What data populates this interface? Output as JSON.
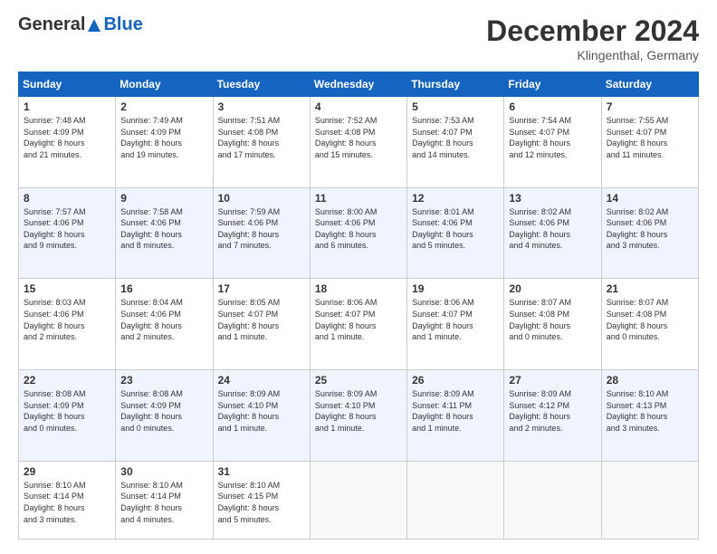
{
  "header": {
    "logo_general": "General",
    "logo_blue": "Blue",
    "month_title": "December 2024",
    "location": "Klingenthal, Germany"
  },
  "weekdays": [
    "Sunday",
    "Monday",
    "Tuesday",
    "Wednesday",
    "Thursday",
    "Friday",
    "Saturday"
  ],
  "rows": [
    [
      {
        "day": "1",
        "lines": [
          "Sunrise: 7:48 AM",
          "Sunset: 4:09 PM",
          "Daylight: 8 hours",
          "and 21 minutes."
        ]
      },
      {
        "day": "2",
        "lines": [
          "Sunrise: 7:49 AM",
          "Sunset: 4:09 PM",
          "Daylight: 8 hours",
          "and 19 minutes."
        ]
      },
      {
        "day": "3",
        "lines": [
          "Sunrise: 7:51 AM",
          "Sunset: 4:08 PM",
          "Daylight: 8 hours",
          "and 17 minutes."
        ]
      },
      {
        "day": "4",
        "lines": [
          "Sunrise: 7:52 AM",
          "Sunset: 4:08 PM",
          "Daylight: 8 hours",
          "and 15 minutes."
        ]
      },
      {
        "day": "5",
        "lines": [
          "Sunrise: 7:53 AM",
          "Sunset: 4:07 PM",
          "Daylight: 8 hours",
          "and 14 minutes."
        ]
      },
      {
        "day": "6",
        "lines": [
          "Sunrise: 7:54 AM",
          "Sunset: 4:07 PM",
          "Daylight: 8 hours",
          "and 12 minutes."
        ]
      },
      {
        "day": "7",
        "lines": [
          "Sunrise: 7:55 AM",
          "Sunset: 4:07 PM",
          "Daylight: 8 hours",
          "and 11 minutes."
        ]
      }
    ],
    [
      {
        "day": "8",
        "lines": [
          "Sunrise: 7:57 AM",
          "Sunset: 4:06 PM",
          "Daylight: 8 hours",
          "and 9 minutes."
        ]
      },
      {
        "day": "9",
        "lines": [
          "Sunrise: 7:58 AM",
          "Sunset: 4:06 PM",
          "Daylight: 8 hours",
          "and 8 minutes."
        ]
      },
      {
        "day": "10",
        "lines": [
          "Sunrise: 7:59 AM",
          "Sunset: 4:06 PM",
          "Daylight: 8 hours",
          "and 7 minutes."
        ]
      },
      {
        "day": "11",
        "lines": [
          "Sunrise: 8:00 AM",
          "Sunset: 4:06 PM",
          "Daylight: 8 hours",
          "and 6 minutes."
        ]
      },
      {
        "day": "12",
        "lines": [
          "Sunrise: 8:01 AM",
          "Sunset: 4:06 PM",
          "Daylight: 8 hours",
          "and 5 minutes."
        ]
      },
      {
        "day": "13",
        "lines": [
          "Sunrise: 8:02 AM",
          "Sunset: 4:06 PM",
          "Daylight: 8 hours",
          "and 4 minutes."
        ]
      },
      {
        "day": "14",
        "lines": [
          "Sunrise: 8:02 AM",
          "Sunset: 4:06 PM",
          "Daylight: 8 hours",
          "and 3 minutes."
        ]
      }
    ],
    [
      {
        "day": "15",
        "lines": [
          "Sunrise: 8:03 AM",
          "Sunset: 4:06 PM",
          "Daylight: 8 hours",
          "and 2 minutes."
        ]
      },
      {
        "day": "16",
        "lines": [
          "Sunrise: 8:04 AM",
          "Sunset: 4:06 PM",
          "Daylight: 8 hours",
          "and 2 minutes."
        ]
      },
      {
        "day": "17",
        "lines": [
          "Sunrise: 8:05 AM",
          "Sunset: 4:07 PM",
          "Daylight: 8 hours",
          "and 1 minute."
        ]
      },
      {
        "day": "18",
        "lines": [
          "Sunrise: 8:06 AM",
          "Sunset: 4:07 PM",
          "Daylight: 8 hours",
          "and 1 minute."
        ]
      },
      {
        "day": "19",
        "lines": [
          "Sunrise: 8:06 AM",
          "Sunset: 4:07 PM",
          "Daylight: 8 hours",
          "and 1 minute."
        ]
      },
      {
        "day": "20",
        "lines": [
          "Sunrise: 8:07 AM",
          "Sunset: 4:08 PM",
          "Daylight: 8 hours",
          "and 0 minutes."
        ]
      },
      {
        "day": "21",
        "lines": [
          "Sunrise: 8:07 AM",
          "Sunset: 4:08 PM",
          "Daylight: 8 hours",
          "and 0 minutes."
        ]
      }
    ],
    [
      {
        "day": "22",
        "lines": [
          "Sunrise: 8:08 AM",
          "Sunset: 4:09 PM",
          "Daylight: 8 hours",
          "and 0 minutes."
        ]
      },
      {
        "day": "23",
        "lines": [
          "Sunrise: 8:08 AM",
          "Sunset: 4:09 PM",
          "Daylight: 8 hours",
          "and 0 minutes."
        ]
      },
      {
        "day": "24",
        "lines": [
          "Sunrise: 8:09 AM",
          "Sunset: 4:10 PM",
          "Daylight: 8 hours",
          "and 1 minute."
        ]
      },
      {
        "day": "25",
        "lines": [
          "Sunrise: 8:09 AM",
          "Sunset: 4:10 PM",
          "Daylight: 8 hours",
          "and 1 minute."
        ]
      },
      {
        "day": "26",
        "lines": [
          "Sunrise: 8:09 AM",
          "Sunset: 4:11 PM",
          "Daylight: 8 hours",
          "and 1 minute."
        ]
      },
      {
        "day": "27",
        "lines": [
          "Sunrise: 8:09 AM",
          "Sunset: 4:12 PM",
          "Daylight: 8 hours",
          "and 2 minutes."
        ]
      },
      {
        "day": "28",
        "lines": [
          "Sunrise: 8:10 AM",
          "Sunset: 4:13 PM",
          "Daylight: 8 hours",
          "and 3 minutes."
        ]
      }
    ],
    [
      {
        "day": "29",
        "lines": [
          "Sunrise: 8:10 AM",
          "Sunset: 4:14 PM",
          "Daylight: 8 hours",
          "and 3 minutes."
        ]
      },
      {
        "day": "30",
        "lines": [
          "Sunrise: 8:10 AM",
          "Sunset: 4:14 PM",
          "Daylight: 8 hours",
          "and 4 minutes."
        ]
      },
      {
        "day": "31",
        "lines": [
          "Sunrise: 8:10 AM",
          "Sunset: 4:15 PM",
          "Daylight: 8 hours",
          "and 5 minutes."
        ]
      },
      null,
      null,
      null,
      null
    ]
  ]
}
